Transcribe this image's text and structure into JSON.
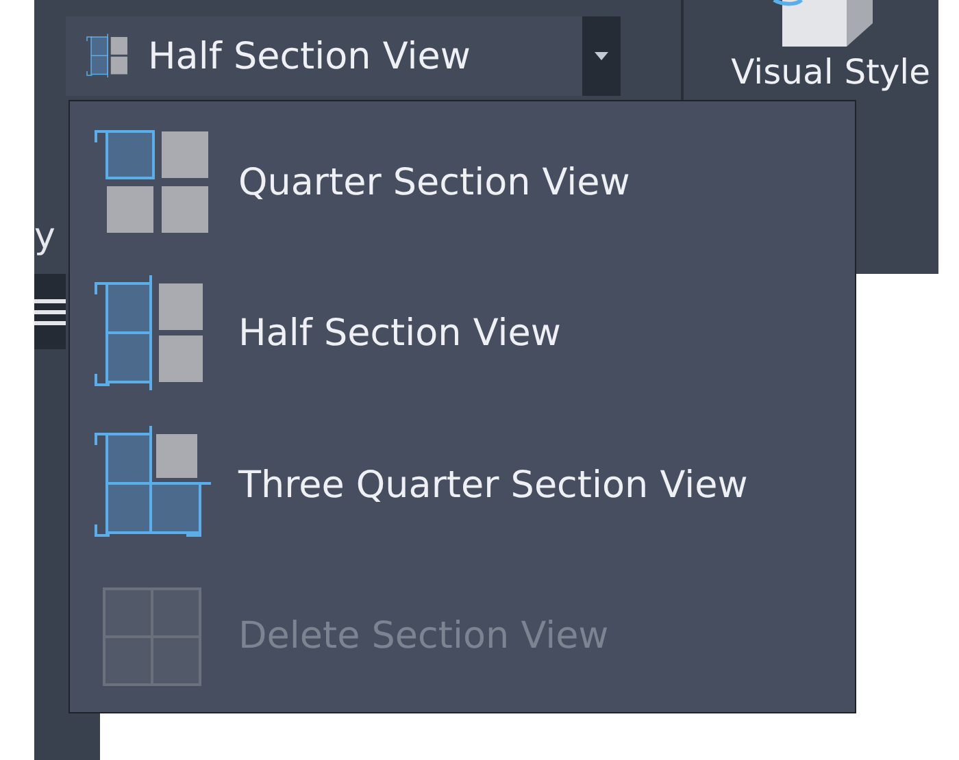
{
  "ribbon": {
    "section_view_button": {
      "label": "Half Section View",
      "kind": "half"
    },
    "visual_style": {
      "label": "Visual Style"
    },
    "side_label": "y"
  },
  "menu": {
    "items": [
      {
        "label": "Quarter Section View",
        "kind": "quarter",
        "disabled": false
      },
      {
        "label": "Half Section View",
        "kind": "half",
        "disabled": false
      },
      {
        "label": "Three Quarter Section View",
        "kind": "three_quarter",
        "disabled": false
      },
      {
        "label": "Delete Section View",
        "kind": "delete",
        "disabled": true
      }
    ]
  }
}
